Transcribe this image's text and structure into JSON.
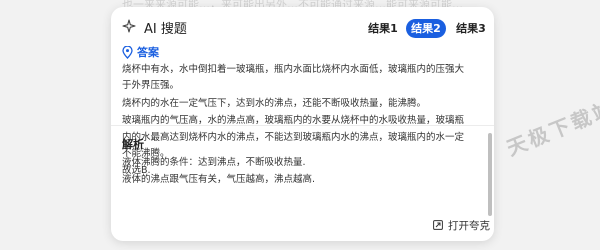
{
  "background_text": "也一来来源可能…，来可能出另外…不可能通过来源…能可来源可能…",
  "header": {
    "title": "AI 搜题",
    "tabs": [
      {
        "label": "结果1",
        "active": false
      },
      {
        "label": "结果2",
        "active": true
      },
      {
        "label": "结果3",
        "active": false
      }
    ]
  },
  "answer": {
    "title": "答案",
    "lines": [
      "烧杯中有水，水中倒扣着一玻璃瓶，瓶内水面比烧杯内水面低，玻璃瓶内的压强大于外界压强。",
      "烧杯内的水在一定气压下，达到水的沸点，还能不断吸收热量，能沸腾。",
      "玻璃瓶内的气压高，水的沸点高，玻璃瓶内的水要从烧杯中的水吸收热量，玻璃瓶内的水最高达到烧杯内水的沸点，不能达到玻璃瓶内水的沸点，玻璃瓶内的水一定不能沸腾。",
      "故选B."
    ]
  },
  "analysis": {
    "title": "解析",
    "lines": [
      "液体沸腾的条件：达到沸点，不断吸收热量.",
      "液体的沸点跟气压有关，气压越高，沸点越高."
    ]
  },
  "footer": {
    "open_label": "打开夸克"
  },
  "watermark": "天极下载站",
  "colors": {
    "accent": "#1a5fe0"
  },
  "icons": [
    "sparkle-icon",
    "location-pin-icon",
    "external-link-icon"
  ]
}
